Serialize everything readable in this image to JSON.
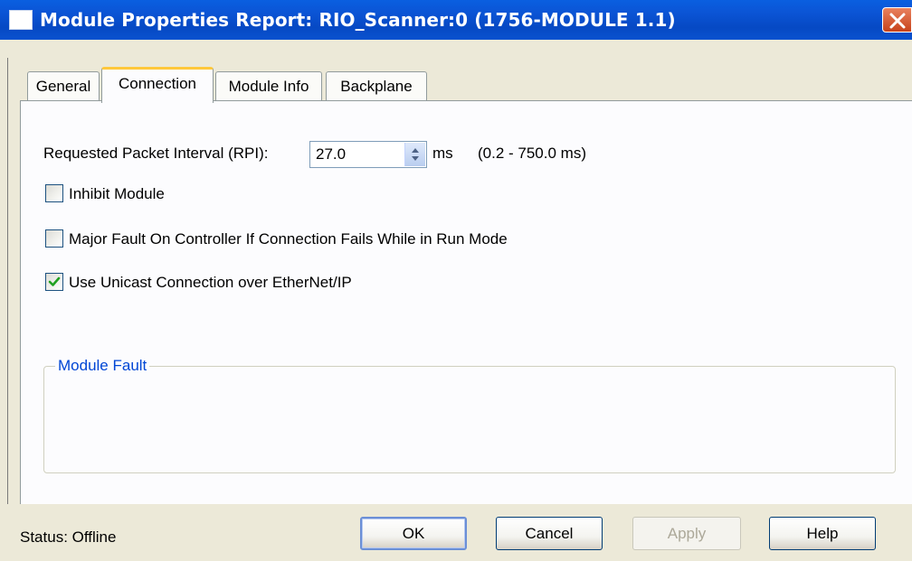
{
  "window": {
    "title": "Module Properties Report: RIO_Scanner:0 (1756-MODULE 1.1)"
  },
  "tabs": [
    {
      "label": "General",
      "active": false
    },
    {
      "label": "Connection",
      "active": true
    },
    {
      "label": "Module Info",
      "active": false
    },
    {
      "label": "Backplane",
      "active": false
    }
  ],
  "connection": {
    "rpi_label": "Requested Packet Interval (RPI):",
    "rpi_value": "27.0",
    "rpi_unit": "ms",
    "rpi_range": "(0.2 - 750.0 ms)",
    "inhibit_label": "Inhibit Module",
    "inhibit_checked": false,
    "major_fault_label": "Major Fault On Controller If Connection Fails While in Run Mode",
    "major_fault_checked": false,
    "unicast_label": "Use Unicast Connection over EtherNet/IP",
    "unicast_checked": true,
    "module_fault_title": "Module Fault"
  },
  "footer": {
    "status_text": "Status:  Offline",
    "ok_label": "OK",
    "cancel_label": "Cancel",
    "apply_label": "Apply",
    "help_label": "Help"
  },
  "colors": {
    "title_bar": "#0a52cf",
    "close_button": "#d1552c",
    "tab_highlight": "#ffc83c",
    "group_title": "#0046d5",
    "checkmark": "#21a121"
  },
  "icons": {
    "window": "window-icon",
    "close": "close-icon",
    "spinner": "spinner-arrows-icon",
    "check": "check-icon"
  }
}
